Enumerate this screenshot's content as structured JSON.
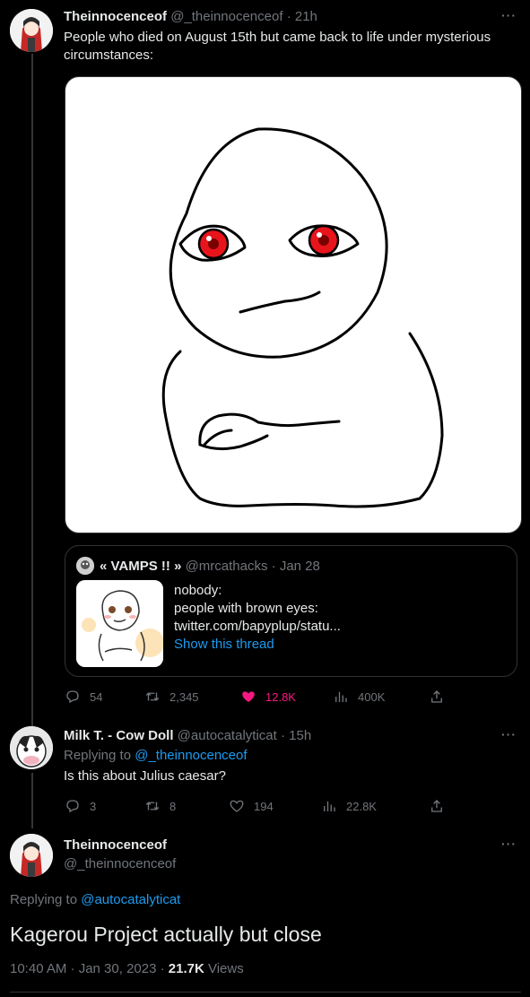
{
  "tweet1": {
    "name": "Theinnocenceof",
    "handle": "@_theinnocenceof",
    "time": "· 21h",
    "text": "People who died on August 15th but came back to life under mysterious circumstances:",
    "quote": {
      "name": "« VAMPS !! »",
      "handle": "@mrcathacks",
      "time": "· Jan 28",
      "line1": "nobody:",
      "line2": "people with brown eyes:",
      "line3": "twitter.com/bapyplup/statu...",
      "show_thread": "Show this thread"
    },
    "actions": {
      "replies": "54",
      "retweets": "2,345",
      "likes": "12.8K",
      "views": "400K"
    }
  },
  "tweet2": {
    "name": "Milk T. - Cow Doll",
    "handle": "@autocatalyticat",
    "time": "· 15h",
    "replying_prefix": "Replying to",
    "replying_to": "@_theinnocenceof",
    "text": "Is this about Julius caesar?",
    "actions": {
      "replies": "3",
      "retweets": "8",
      "likes": "194",
      "views": "22.8K"
    }
  },
  "tweet3": {
    "name": "Theinnocenceof",
    "handle": "@_theinnocenceof",
    "replying_prefix": "Replying to",
    "replying_to": "@autocatalyticat",
    "text": "Kagerou Project actually but close",
    "timestamp": "10:40 AM · Jan 30, 2023 · ",
    "views_count": "21.7K",
    "views_label": " Views"
  },
  "colors": {
    "accent": "#1d9bf0",
    "like": "#f91880",
    "muted": "#71767b",
    "eye": "#e8141c"
  },
  "icons": [
    "more-icon",
    "reply-icon",
    "retweet-icon",
    "heart-icon",
    "views-icon",
    "share-icon"
  ]
}
